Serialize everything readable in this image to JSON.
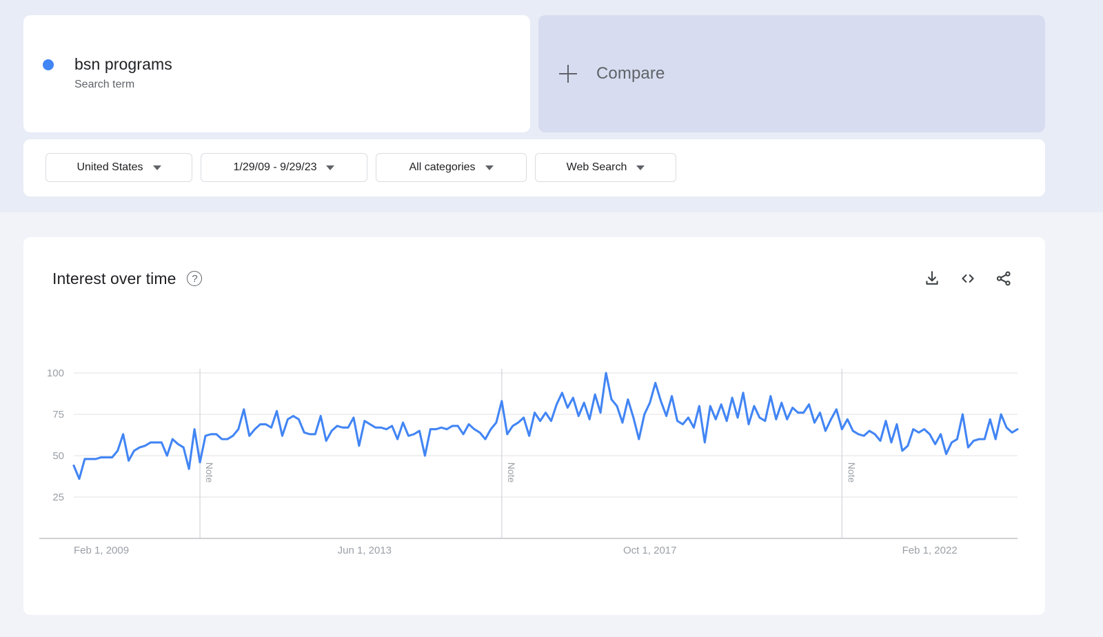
{
  "colors": {
    "series": "#4285f4",
    "page_bg": "#f1f3f8",
    "header_bg": "#e8ecf7",
    "compare_bg": "#d7dcf0",
    "card_bg": "#ffffff",
    "text_primary": "#202124",
    "text_secondary": "#5f6368",
    "axis_text": "#9aa0a6",
    "grid": "#e0e0e0"
  },
  "query": {
    "term": "bsn programs",
    "subtitle": "Search term",
    "dot_color": "#4285f4"
  },
  "compare": {
    "label": "Compare",
    "plus_icon": "plus-icon"
  },
  "filters": [
    {
      "label": "United States",
      "icon": "chevron-down-icon"
    },
    {
      "label": "1/29/09 - 9/29/23",
      "icon": "chevron-down-icon"
    },
    {
      "label": "All categories",
      "icon": "chevron-down-icon"
    },
    {
      "label": "Web Search",
      "icon": "chevron-down-icon"
    }
  ],
  "chart_card": {
    "title": "Interest over time",
    "help_icon": "help-circle-icon",
    "help_glyph": "?",
    "actions": [
      {
        "name": "download-icon",
        "label": "Download CSV"
      },
      {
        "name": "embed-code-icon",
        "label": "Embed"
      },
      {
        "name": "share-icon",
        "label": "Share"
      }
    ]
  },
  "chart_data": {
    "type": "line",
    "title": "Interest over time",
    "series_name": "bsn programs",
    "color": "#4285f4",
    "xlabel": "",
    "ylabel": "",
    "ylim": [
      0,
      100
    ],
    "yticks": [
      25,
      50,
      75,
      100
    ],
    "ytick_labels": [
      "25",
      "50",
      "75",
      "100"
    ],
    "grid": true,
    "legend": false,
    "x_start": "Feb 1, 2009",
    "x_end": "Sep 1, 2023",
    "xtick_labels": [
      "Feb 1, 2009",
      "Jun 1, 2013",
      "Oct 1, 2017",
      "Feb 1, 2022"
    ],
    "xtick_positions": [
      0,
      53,
      105,
      156
    ],
    "annotations": [
      {
        "label": "Note",
        "x_index": 23
      },
      {
        "label": "Note",
        "x_index": 78
      },
      {
        "label": "Note",
        "x_index": 140
      }
    ],
    "x_count": 176,
    "values": [
      44,
      36,
      48,
      48,
      48,
      49,
      49,
      49,
      53,
      63,
      47,
      53,
      55,
      56,
      58,
      58,
      58,
      50,
      60,
      57,
      55,
      42,
      66,
      46,
      62,
      63,
      63,
      60,
      60,
      62,
      66,
      78,
      62,
      66,
      69,
      69,
      67,
      77,
      62,
      72,
      74,
      72,
      64,
      63,
      63,
      74,
      59,
      65,
      68,
      67,
      67,
      73,
      56,
      71,
      69,
      67,
      67,
      66,
      68,
      60,
      70,
      62,
      63,
      65,
      50,
      66,
      66,
      67,
      66,
      68,
      68,
      63,
      69,
      66,
      64,
      60,
      66,
      70,
      83,
      63,
      68,
      70,
      73,
      62,
      76,
      71,
      76,
      71,
      81,
      88,
      79,
      85,
      74,
      82,
      72,
      87,
      76,
      100,
      84,
      80,
      70,
      84,
      73,
      60,
      75,
      82,
      94,
      83,
      74,
      86,
      71,
      69,
      73,
      67,
      80,
      58,
      80,
      72,
      81,
      71,
      85,
      73,
      88,
      69,
      80,
      73,
      71,
      86,
      72,
      82,
      72,
      79,
      76,
      76,
      81,
      70,
      76,
      65,
      72,
      78,
      66,
      72,
      65,
      63,
      62,
      65,
      63,
      59,
      71,
      58,
      69,
      53,
      56,
      66,
      64,
      66,
      63,
      57,
      63,
      51,
      58,
      60,
      75,
      55,
      59,
      60,
      60,
      72,
      60,
      75,
      67,
      64,
      66
    ]
  }
}
